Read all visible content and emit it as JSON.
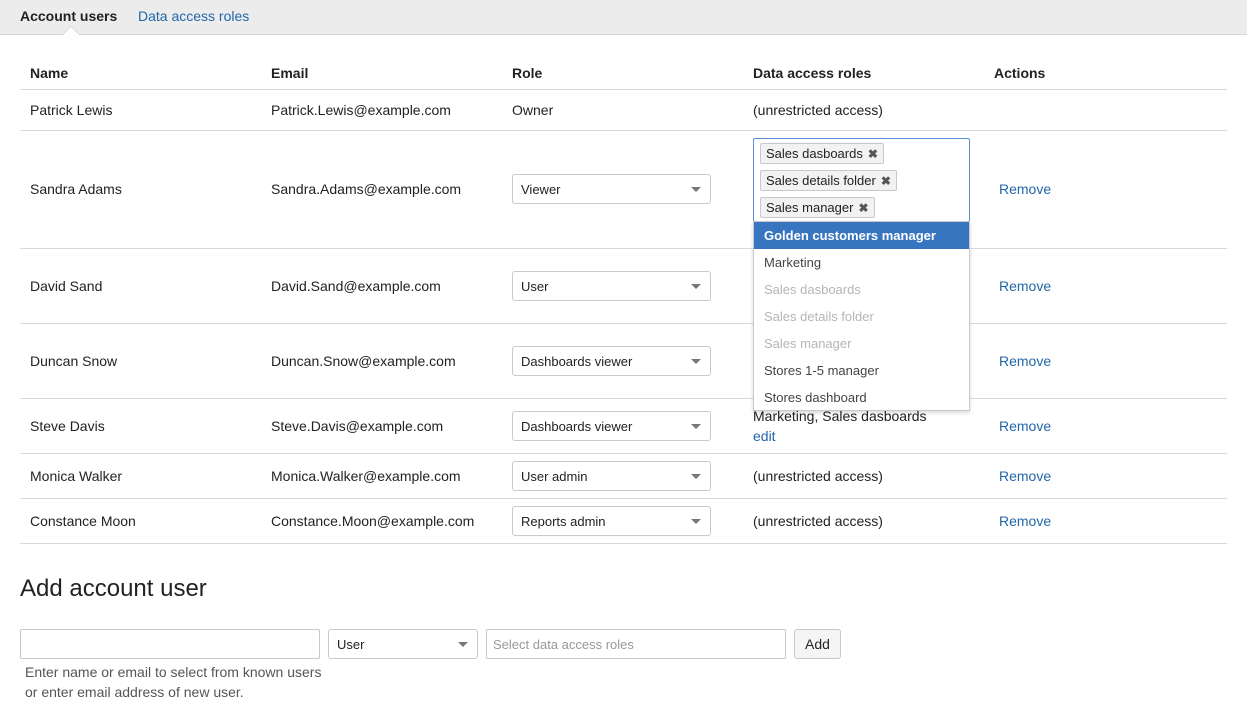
{
  "tabs": [
    {
      "label": "Account users",
      "active": true
    },
    {
      "label": "Data access roles",
      "active": false
    }
  ],
  "table": {
    "headers": [
      "Name",
      "Email",
      "Role",
      "Data access roles",
      "Actions"
    ],
    "rows": [
      {
        "name": "Patrick Lewis",
        "email": "Patrick.Lewis@example.com",
        "role": "Owner",
        "access": "(unrestricted access)",
        "action": ""
      },
      {
        "name": "Sandra Adams",
        "email": "Sandra.Adams@example.com",
        "role": "Viewer",
        "access": "",
        "action": "Remove"
      },
      {
        "name": "David Sand",
        "email": "David.Sand@example.com",
        "role": "User",
        "access": "",
        "action": "Remove"
      },
      {
        "name": "Duncan Snow",
        "email": "Duncan.Snow@example.com",
        "role": "Dashboards viewer",
        "access": "",
        "action": "Remove"
      },
      {
        "name": "Steve Davis",
        "email": "Steve.Davis@example.com",
        "role": "Dashboards viewer",
        "access": "Marketing, Sales dasboards",
        "edit": "edit",
        "action": "Remove"
      },
      {
        "name": "Monica Walker",
        "email": "Monica.Walker@example.com",
        "role": "User admin",
        "access": "(unrestricted access)",
        "action": "Remove"
      },
      {
        "name": "Constance Moon",
        "email": "Constance.Moon@example.com",
        "role": "Reports admin",
        "access": "(unrestricted access)",
        "action": "Remove"
      }
    ]
  },
  "tag_editor": {
    "tags": [
      "Sales dasboards",
      "Sales details folder",
      "Sales manager"
    ],
    "remove_glyph": "✖",
    "options": [
      {
        "label": "Golden customers manager",
        "state": "highlighted"
      },
      {
        "label": "Marketing",
        "state": "normal"
      },
      {
        "label": "Sales dasboards",
        "state": "disabled"
      },
      {
        "label": "Sales details folder",
        "state": "disabled"
      },
      {
        "label": "Sales manager",
        "state": "disabled"
      },
      {
        "label": "Stores 1-5 manager",
        "state": "normal"
      },
      {
        "label": "Stores dashboard",
        "state": "normal"
      }
    ]
  },
  "add_user": {
    "title": "Add account user",
    "name_value": "",
    "role_value": "User",
    "roles_placeholder": "Select data access roles",
    "add_label": "Add",
    "hint_line1": "Enter name or email to select from known users",
    "hint_line2": "or enter email address of new user."
  },
  "colors": {
    "link": "#2167ab",
    "highlight": "#3875c0",
    "tab_bar": "#ececec"
  }
}
